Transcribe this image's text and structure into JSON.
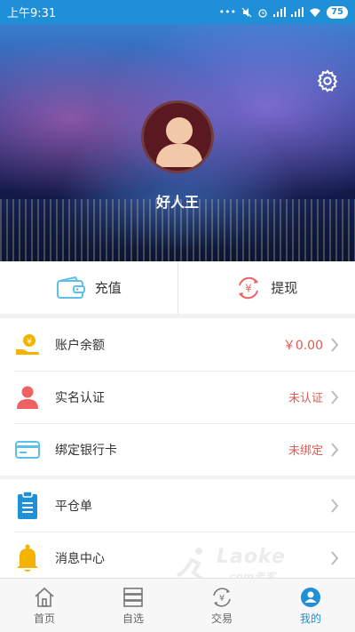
{
  "status_bar": {
    "time": "上午9:31",
    "icons": [
      "dots-icon",
      "mute-icon",
      "alarm-icon",
      "signal-icon",
      "signal-icon",
      "wifi-icon"
    ],
    "battery": "75"
  },
  "profile": {
    "username": "好人王"
  },
  "actions": [
    {
      "label": "充值",
      "icon": "wallet-icon"
    },
    {
      "label": "提现",
      "icon": "yuan-exchange-icon"
    }
  ],
  "account_list": [
    {
      "label": "账户余额",
      "value": "￥0.00",
      "icon": "coin-hand-icon"
    },
    {
      "label": "实名认证",
      "value": "未认证",
      "icon": "person-icon"
    },
    {
      "label": "绑定银行卡",
      "value": "未绑定",
      "icon": "bank-card-icon"
    }
  ],
  "other_list": [
    {
      "label": "平仓单",
      "icon": "clipboard-icon"
    },
    {
      "label": "消息中心",
      "icon": "bell-icon"
    }
  ],
  "watermark": {
    "line1": "Laoke",
    "line2": ".com老客"
  },
  "tabs": [
    {
      "label": "首页",
      "icon": "home-icon",
      "active": false
    },
    {
      "label": "自选",
      "icon": "server-icon",
      "active": false
    },
    {
      "label": "交易",
      "icon": "trade-icon",
      "active": false
    },
    {
      "label": "我的",
      "icon": "user-circle-icon",
      "active": true
    }
  ],
  "colors": {
    "primary": "#1f8fd8",
    "alert_text": "#e05a4f",
    "gold": "#f5b301",
    "red": "#f06262"
  }
}
